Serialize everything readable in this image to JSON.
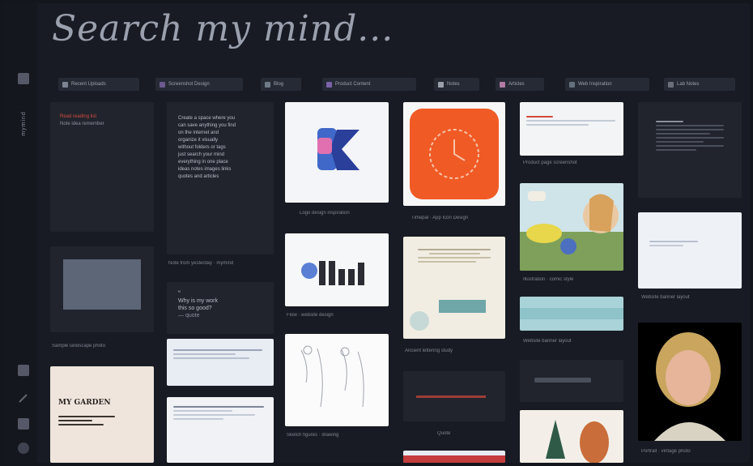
{
  "app": {
    "title": "Search my mind...",
    "sidebar_label": "mymind"
  },
  "tags": [
    {
      "label": "Recent Uploads",
      "color": "#7d8594"
    },
    {
      "label": "Screenshot Design",
      "color": "#6c5a90"
    },
    {
      "label": "Blog",
      "color": "#6e7a86"
    },
    {
      "label": "Product Content",
      "color": "#7a63a8"
    },
    {
      "label": "Notes",
      "color": "#9aa0aa"
    },
    {
      "label": "Articles",
      "color": "#b07aa4"
    },
    {
      "label": "Web Inspiration",
      "color": "#64707c"
    },
    {
      "label": "Lab Notes",
      "color": "#6a6f78"
    }
  ],
  "cards": {
    "red_note": {
      "lines": [
        "Read reading list",
        "Note idea remember"
      ]
    },
    "text_note": {
      "lines": [
        "Create a space where you",
        "can save anything you find",
        "on the internet and",
        "organize it visually",
        "without folders or tags",
        "just search your mind",
        "everything in one place",
        "ideas notes images links",
        "quotes and articles"
      ],
      "caption": "Note from yesterday · mymind"
    },
    "quote_note": {
      "lines": [
        "“",
        "Why is my work",
        "this so good?",
        "— quote"
      ]
    },
    "gray_image_caption": "Sample landscape photo",
    "logo_caption": "Logo design inspiration",
    "clock_caption": "Timepal · App Icon Design",
    "flow_caption": "Flow · website design",
    "parchment_caption": "Ancient lettering study",
    "sketch_caption": "Sketch figures · drawing",
    "cartoon_caption": "Illustration · comic style",
    "banner_caption": "Website banner layout",
    "portrait_caption": "Portrait · vintage photo",
    "red_text_caption": "Quote",
    "card6_caption": "Product page screenshot",
    "poster_title": "MY GARDEN"
  },
  "colors": {
    "accent_red": "#d24a3a",
    "clock_orange": "#f05a25",
    "logo_blue": "#3f68c8",
    "logo_pink": "#e070b0"
  }
}
